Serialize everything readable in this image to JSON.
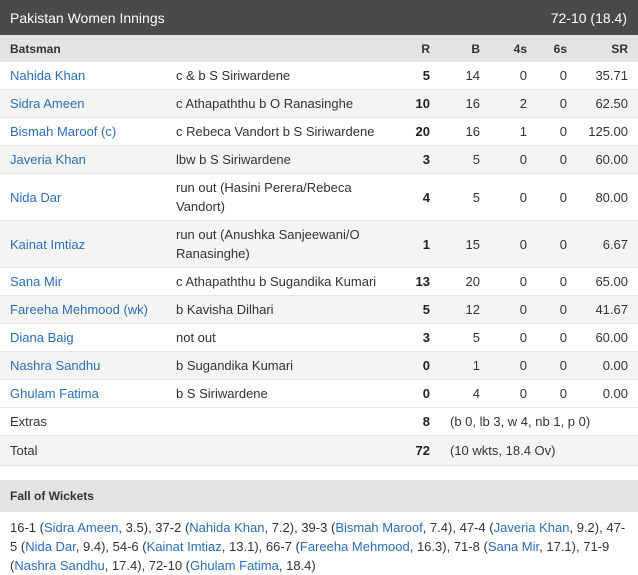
{
  "header": {
    "title": "Pakistan Women Innings",
    "score": "72-10 (18.4)"
  },
  "columns": {
    "batsman": "Batsman",
    "r": "R",
    "b": "B",
    "fours": "4s",
    "sixes": "6s",
    "sr": "SR"
  },
  "batting": [
    {
      "name": "Nahida Khan",
      "dismissal": "c & b S Siriwardene",
      "r": "5",
      "b": "14",
      "fours": "0",
      "sixes": "0",
      "sr": "35.71"
    },
    {
      "name": "Sidra Ameen",
      "dismissal": "c Athapaththu b O Ranasinghe",
      "r": "10",
      "b": "16",
      "fours": "2",
      "sixes": "0",
      "sr": "62.50"
    },
    {
      "name": "Bismah Maroof (c)",
      "dismissal": "c Rebeca Vandort b S Siriwardene",
      "r": "20",
      "b": "16",
      "fours": "1",
      "sixes": "0",
      "sr": "125.00"
    },
    {
      "name": "Javeria Khan",
      "dismissal": "lbw b S Siriwardene",
      "r": "3",
      "b": "5",
      "fours": "0",
      "sixes": "0",
      "sr": "60.00"
    },
    {
      "name": "Nida Dar",
      "dismissal": "run out (Hasini Perera/Rebeca Vandort)",
      "r": "4",
      "b": "5",
      "fours": "0",
      "sixes": "0",
      "sr": "80.00",
      "wrap": true
    },
    {
      "name": "Kainat Imtiaz",
      "dismissal": "run out (Anushka Sanjeewani/O Ranasinghe)",
      "r": "1",
      "b": "15",
      "fours": "0",
      "sixes": "0",
      "sr": "6.67",
      "wrap": true
    },
    {
      "name": "Sana Mir",
      "dismissal": "c Athapaththu b Sugandika Kumari",
      "r": "13",
      "b": "20",
      "fours": "0",
      "sixes": "0",
      "sr": "65.00"
    },
    {
      "name": "Fareeha Mehmood (wk)",
      "dismissal": "b Kavisha Dilhari",
      "r": "5",
      "b": "12",
      "fours": "0",
      "sixes": "0",
      "sr": "41.67"
    },
    {
      "name": "Diana Baig",
      "dismissal": "not out",
      "r": "3",
      "b": "5",
      "fours": "0",
      "sixes": "0",
      "sr": "60.00"
    },
    {
      "name": "Nashra Sandhu",
      "dismissal": "b Sugandika Kumari",
      "r": "0",
      "b": "1",
      "fours": "0",
      "sixes": "0",
      "sr": "0.00"
    },
    {
      "name": "Ghulam Fatima",
      "dismissal": "b S Siriwardene",
      "r": "0",
      "b": "4",
      "fours": "0",
      "sixes": "0",
      "sr": "0.00"
    }
  ],
  "extras": {
    "label": "Extras",
    "value": "8",
    "detail": "(b 0, lb 3, w 4, nb 1, p 0)"
  },
  "total": {
    "label": "Total",
    "value": "72",
    "detail": "(10 wkts, 18.4 Ov)"
  },
  "fow": {
    "title": "Fall of Wickets",
    "items": [
      {
        "score": "16-1",
        "player": "Sidra Ameen",
        "over": "3.5"
      },
      {
        "score": "37-2",
        "player": "Nahida Khan",
        "over": "7.2"
      },
      {
        "score": "39-3",
        "player": "Bismah Maroof",
        "over": "7.4"
      },
      {
        "score": "47-4",
        "player": "Javeria Khan",
        "over": "9.2"
      },
      {
        "score": "47-5",
        "player": "Nida Dar",
        "over": "9.4"
      },
      {
        "score": "54-6",
        "player": "Kainat Imtiaz",
        "over": "13.1"
      },
      {
        "score": "66-7",
        "player": "Fareeha Mehmood",
        "over": "16.3"
      },
      {
        "score": "71-8",
        "player": "Sana Mir",
        "over": "17.1"
      },
      {
        "score": "71-9",
        "player": "Nashra Sandhu",
        "over": "17.4"
      },
      {
        "score": "72-10",
        "player": "Ghulam Fatima",
        "over": "18.4"
      }
    ]
  }
}
